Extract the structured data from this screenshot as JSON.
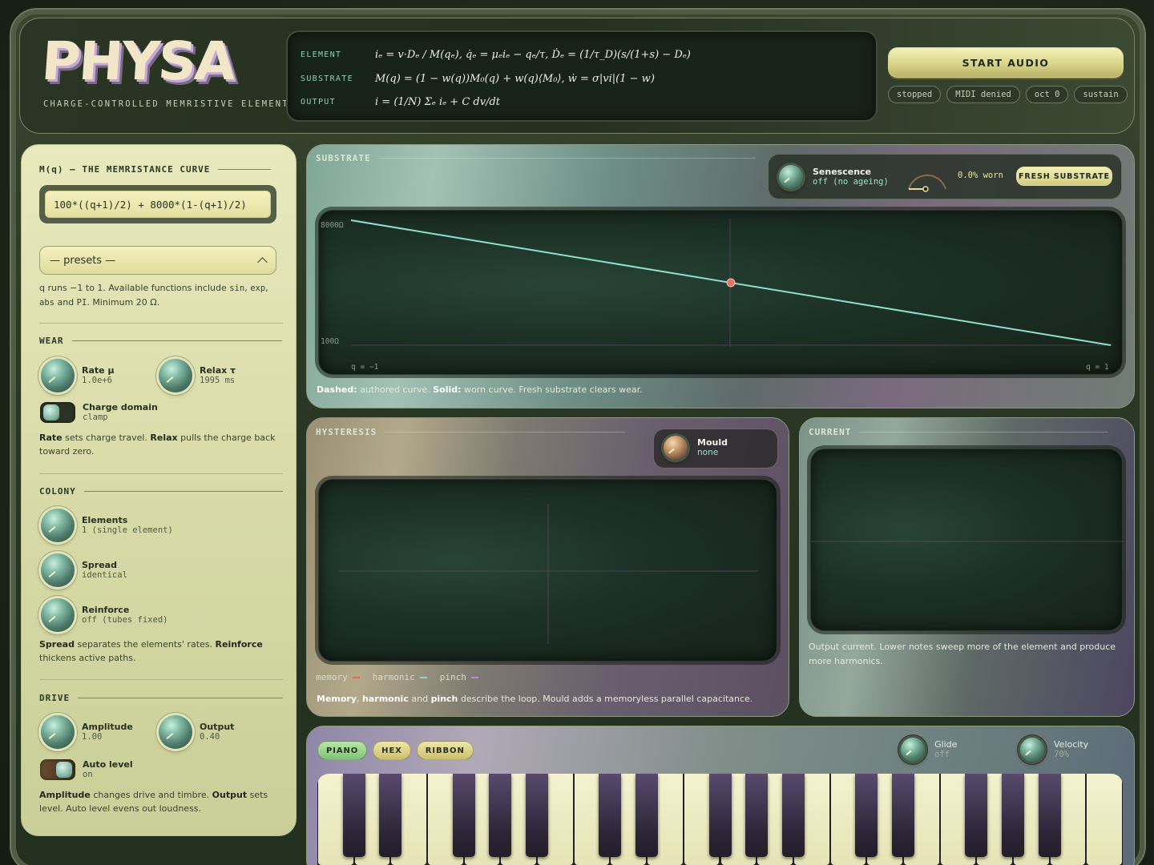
{
  "header": {
    "logo": "PHYSA",
    "tagline": "CHARGE-CONTROLLED MEMRISTIVE ELEMENT",
    "equations": [
      {
        "label": "ELEMENT",
        "expr": "iₑ = v·Dₑ / M(qₑ),   q̇ₑ = μₑiₑ − qₑ/τ,   Ḋₑ = (1/τ_D)(s/(1+s) − Dₑ)"
      },
      {
        "label": "SUBSTRATE",
        "expr": "M(q) = (1 − w(q))M₀(q) + w(q)⟨M₀⟩,   ẇ = σ|vi|(1 − w)"
      },
      {
        "label": "OUTPUT",
        "expr": "i = (1/N) Σₑ iₑ + C dv/dt"
      }
    ],
    "start_label": "START AUDIO",
    "status_chips": [
      "stopped",
      "MIDI denied",
      "oct 0",
      "sustain"
    ]
  },
  "left": {
    "curve_title": "M(q) — THE MEMRISTANCE CURVE",
    "expression": "100*((q+1)/2) + 8000*(1-(q+1)/2)",
    "presets_label": "— presets —",
    "help_parts": [
      "q runs −1 to 1. Available functions include ",
      "sin",
      ", ",
      "exp",
      ", ",
      "abs",
      " and ",
      "PI",
      ". Minimum 20 Ω."
    ],
    "wear": {
      "title": "WEAR",
      "rate_label": "Rate μ",
      "rate_value": "1.0e+6",
      "relax_label": "Relax τ",
      "relax_value": "1995 ms",
      "domain_label": "Charge domain",
      "domain_value": "clamp",
      "help_b1": "Rate",
      "help_t1": " sets charge travel. ",
      "help_b2": "Relax",
      "help_t2": " pulls the charge back toward zero."
    },
    "colony": {
      "title": "COLONY",
      "elements_label": "Elements",
      "elements_value": "1 (single element)",
      "spread_label": "Spread",
      "spread_value": "identical",
      "reinforce_label": "Reinforce",
      "reinforce_value": "off (tubes fixed)",
      "help_b1": "Spread",
      "help_t1": " separates the elements' rates. ",
      "help_b2": "Reinforce",
      "help_t2": " thickens active paths."
    },
    "drive": {
      "title": "DRIVE",
      "amp_label": "Amplitude",
      "amp_value": "1.00",
      "out_label": "Output",
      "out_value": "0.40",
      "auto_label": "Auto level",
      "auto_value": "on",
      "help_b1": "Amplitude",
      "help_t1": " changes drive and timbre. ",
      "help_b2": "Output",
      "help_t2": " sets level. Auto level evens out loudness."
    }
  },
  "substrate": {
    "title": "SUBSTRATE",
    "senescence_label": "Senescence",
    "senescence_value": "off (no ageing)",
    "worn_text": "0.0% worn",
    "wear_fraction": 0.0,
    "fresh_label": "FRESH SUBSTRATE",
    "y_max_label": "8000Ω",
    "y_min_label": "100Ω",
    "x_min_label": "q = −1",
    "x_max_label": "q = 1",
    "cap_b1": "Dashed:",
    "cap_t1": " authored curve. ",
    "cap_b2": "Solid:",
    "cap_t2": " worn curve. Fresh substrate clears wear."
  },
  "chart_data": {
    "type": "line",
    "x": [
      -1,
      1
    ],
    "series": [
      {
        "values": [
          8000,
          100
        ]
      }
    ],
    "xlim": [
      -1,
      1
    ],
    "ylim": [
      100,
      8000
    ],
    "marker": {
      "x": 0,
      "y": 4050
    },
    "grid": false
  },
  "hysteresis": {
    "title": "HYSTERESIS",
    "mould_label": "Mould",
    "mould_value": "none",
    "legend": [
      {
        "name": "memory",
        "color": "#e0704f"
      },
      {
        "name": "harmonic",
        "color": "#8fd0e0"
      },
      {
        "name": "pinch",
        "color": "#b88ae0"
      }
    ],
    "cap_b1": "Memory",
    "cap_t1": ", ",
    "cap_b2": "harmonic",
    "cap_t2": " and ",
    "cap_b3": "pinch",
    "cap_t3": " describe the loop. Mould adds a memoryless parallel capacitance."
  },
  "current": {
    "title": "CURRENT",
    "caption": "Output current. Lower notes sweep more of the element and produce more harmonics."
  },
  "keyboard": {
    "tabs": [
      "PIANO",
      "HEX",
      "RIBBON"
    ],
    "glide_label": "Glide",
    "glide_value": "off",
    "velocity_label": "Velocity",
    "velocity_value": "70%"
  },
  "colors": {
    "curve": "#8fe0cc",
    "marker": "#e07a5f",
    "accent_yellow": "#e5e09a"
  }
}
